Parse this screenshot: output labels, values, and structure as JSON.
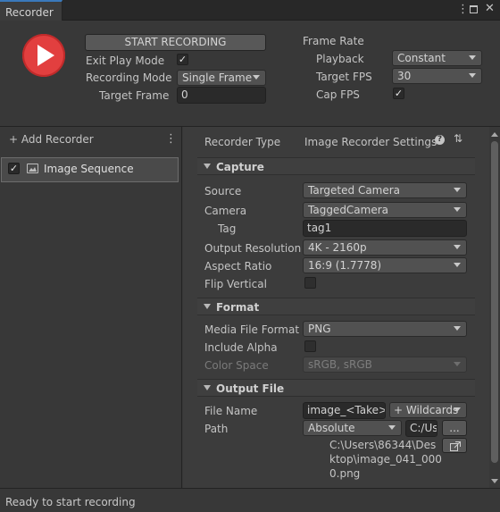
{
  "window": {
    "tab_title": "Recorder",
    "menu_icon": "kebab-menu-icon",
    "maximize_icon": "maximize-icon",
    "close_icon": "close-icon"
  },
  "header": {
    "play_icon": "play-icon",
    "start_button": "START RECORDING",
    "exit_play_mode_label": "Exit Play Mode",
    "exit_play_mode_checked": true,
    "recording_mode_label": "Recording Mode",
    "recording_mode_value": "Single Frame",
    "target_frame_label": "Target Frame",
    "target_frame_value": "0",
    "frame_rate_title": "Frame Rate",
    "playback_label": "Playback",
    "playback_value": "Constant",
    "target_fps_label": "Target FPS",
    "target_fps_value": "30",
    "cap_fps_label": "Cap FPS",
    "cap_fps_checked": true
  },
  "left_panel": {
    "add_recorder_label": "+ Add Recorder",
    "recorders": [
      {
        "label": "Image Sequence",
        "enabled": true,
        "icon": "image-sequence-icon"
      }
    ]
  },
  "right_panel": {
    "recorder_type_label": "Recorder Type",
    "recorder_type_value": "Image Recorder Settings",
    "help_icon": "help-icon",
    "settings_icon": "preset-settings-icon",
    "capture": {
      "title": "Capture",
      "source_label": "Source",
      "source_value": "Targeted Camera",
      "camera_label": "Camera",
      "camera_value": "TaggedCamera",
      "tag_label": "Tag",
      "tag_value": "tag1",
      "output_resolution_label": "Output Resolution",
      "output_resolution_value": "4K - 2160p",
      "aspect_ratio_label": "Aspect Ratio",
      "aspect_ratio_value": "16:9 (1.7778)",
      "flip_vertical_label": "Flip Vertical",
      "flip_vertical_checked": false
    },
    "format": {
      "title": "Format",
      "media_file_format_label": "Media File Format",
      "media_file_format_value": "PNG",
      "include_alpha_label": "Include Alpha",
      "include_alpha_checked": false,
      "color_space_label": "Color Space",
      "color_space_value": "sRGB, sRGB"
    },
    "output_file": {
      "title": "Output File",
      "file_name_label": "File Name",
      "file_name_value": "image_<Take>.",
      "wildcards_button": "+ Wildcards",
      "path_label": "Path",
      "path_type_value": "Absolute",
      "path_value": "C:/Us",
      "browse_button": "...",
      "reveal_icon": "open-folder-icon",
      "full_path_line1": "C:\\Users\\86344\\Des",
      "full_path_line2": "ktop\\image_041_000",
      "full_path_line3": "0.png"
    }
  },
  "status_bar": {
    "text": "Ready to start recording"
  },
  "colors": {
    "accent_tab": "#3a79bb",
    "record_button": "#e23f3f",
    "background": "#383838"
  }
}
